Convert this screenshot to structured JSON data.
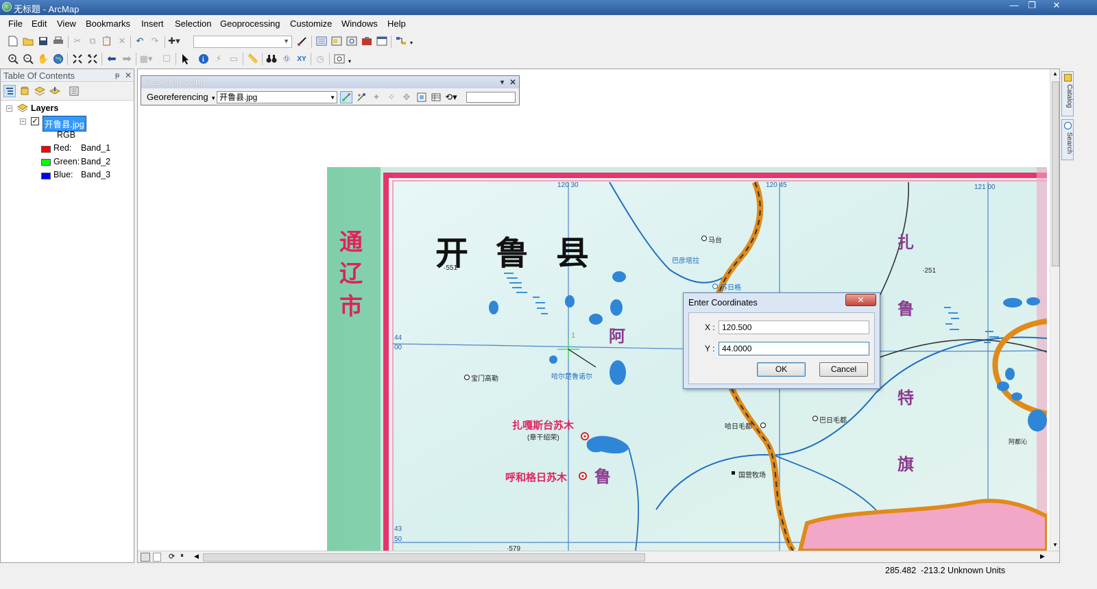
{
  "window": {
    "title": "无标题 - ArcMap",
    "controls": [
      "—",
      "❐",
      "✕"
    ]
  },
  "menu": [
    "File",
    "Edit",
    "View",
    "Bookmarks",
    "Insert",
    "Selection",
    "Geoprocessing",
    "Customize",
    "Windows",
    "Help"
  ],
  "toc": {
    "title": "Table Of Contents",
    "pin": "ᵽ",
    "close": "✕",
    "root": "Layers",
    "layer": "开鲁县.jpg",
    "rgb": "RGB",
    "bands": [
      {
        "channel": "Red:",
        "band": "Band_1",
        "color": "#ff0000"
      },
      {
        "channel": "Green:",
        "band": "Band_2",
        "color": "#00ff00"
      },
      {
        "channel": "Blue:",
        "band": "Band_3",
        "color": "#0000ff"
      }
    ]
  },
  "georef": {
    "title": "Georeferencing",
    "menu_label": "Georeferencing",
    "layer_select": "开鲁县.jpg"
  },
  "map": {
    "title_chars": [
      "开",
      "鲁",
      "县"
    ],
    "side_label": [
      "通",
      "辽",
      "市"
    ],
    "right_label": [
      "扎",
      "鲁",
      "特",
      "旗"
    ],
    "a_char": "阿",
    "lu_char": "鲁",
    "grid_top": [
      "120 30",
      "120 45",
      "121 00"
    ],
    "grid_left_top": [
      "44",
      "00"
    ],
    "grid_left_bottom": [
      "43",
      "50"
    ],
    "elev1": "·551",
    "elev2": "·251",
    "towns": [
      {
        "name": "宝门高勒"
      },
      {
        "name": "哈尔楚鲁诺尔"
      },
      {
        "name": "巴日毛都"
      },
      {
        "name": "国营牧场"
      },
      {
        "name": "扎嘎斯台苏木"
      },
      {
        "name": "(章干绍荣)"
      },
      {
        "name": "呼和格日苏木"
      },
      {
        "name": "阿都沁"
      },
      {
        "name": "哈日毛都"
      },
      {
        "name": "马台"
      },
      {
        "name": "巴彦塔拉"
      },
      {
        "name": "苏日格"
      }
    ],
    "bottom_label": "·579",
    "control_point": "1"
  },
  "dialog": {
    "title": "Enter Coordinates",
    "x_label": "X :",
    "x_value": "120.500",
    "y_label": "Y :",
    "y_value": "44.0000",
    "ok": "OK",
    "cancel": "Cancel"
  },
  "sidetabs": [
    "Catalog",
    "Search"
  ],
  "status": {
    "coords": "285.482  -213.2 Unknown Units"
  },
  "colors": {
    "titlebar": "#2b5a9a",
    "map_border": "#e8336e",
    "river": "#1f6fbf",
    "road": "#e08a1a"
  }
}
